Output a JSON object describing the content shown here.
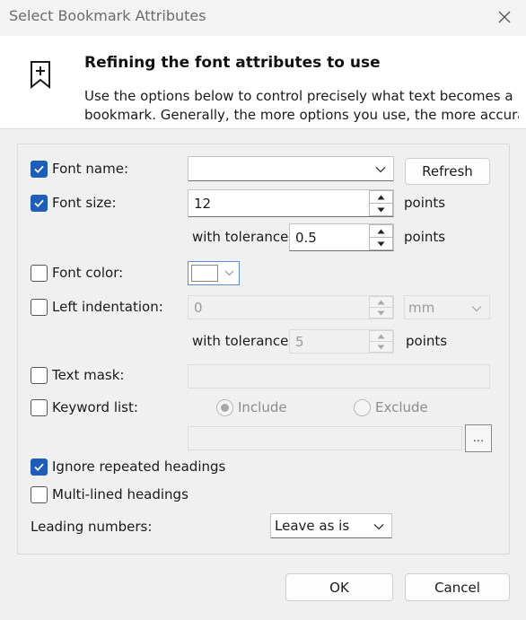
{
  "window": {
    "title": "Select Bookmark Attributes"
  },
  "header": {
    "title": "Refining the font attributes to use",
    "desc_line1": "Use the options below to control precisely what text becomes a",
    "desc_line2": "bookmark. Generally, the more options you use, the more accura..."
  },
  "font_name": {
    "label": "Font name:",
    "checked": true,
    "value": "",
    "refresh_label": "Refresh"
  },
  "font_size": {
    "label": "Font size:",
    "checked": true,
    "value": "12",
    "unit": "points",
    "tolerance_label": "with tolerance",
    "tolerance_value": "0.5",
    "tolerance_unit": "points"
  },
  "font_color": {
    "label": "Font color:",
    "checked": false,
    "swatch": "#ffffff"
  },
  "left_indent": {
    "label": "Left indentation:",
    "checked": false,
    "value": "0",
    "unit": "mm",
    "tolerance_label": "with tolerance",
    "tolerance_value": "5",
    "tolerance_unit": "points"
  },
  "text_mask": {
    "label": "Text mask:",
    "checked": false,
    "value": ""
  },
  "keyword_list": {
    "label": "Keyword list:",
    "checked": false,
    "include_label": "Include",
    "exclude_label": "Exclude",
    "selected": "include",
    "value": "",
    "browse_label": "..."
  },
  "ignore_repeated": {
    "label": "Ignore repeated headings",
    "checked": true
  },
  "multi_lined": {
    "label": "Multi-lined headings",
    "checked": false
  },
  "leading_numbers": {
    "label": "Leading numbers:",
    "value": "Leave as is"
  },
  "buttons": {
    "ok": "OK",
    "cancel": "Cancel"
  },
  "colors": {
    "accent": "#1f5eb8",
    "window_bg": "#f0f0f0",
    "header_bg": "#ffffff"
  }
}
